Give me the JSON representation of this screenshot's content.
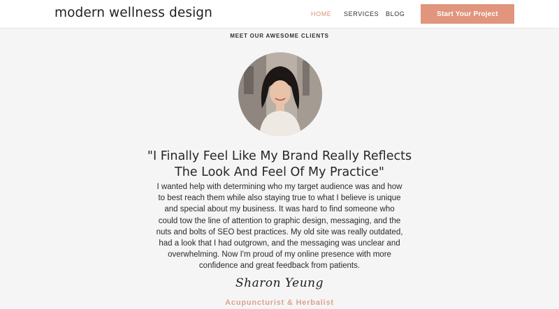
{
  "header": {
    "logo": "modern wellness design",
    "nav": [
      {
        "label": "HOME",
        "active": true
      },
      {
        "label": "SERVICES",
        "active": false
      },
      {
        "label": "BLOG",
        "active": false
      }
    ],
    "cta_label": "Start Your Project"
  },
  "section": {
    "eyebrow": "MEET OUR AWESOME CLIENTS"
  },
  "testimonial": {
    "quote_lines": [
      "\"I Finally Feel Like My Brand Really Reflects",
      "The Look And Feel Of My Practice\""
    ],
    "body_lines": [
      "I wanted help with determining who my target audience was and how",
      "to best reach them while also staying true to what I believe is unique",
      "and special about my business. It was hard to find someone who",
      "could tow the line of attention to graphic design, messaging, and the",
      "nuts and bolts of SEO best practices. My old site was really outdated,",
      "had a look that I had outgrown, and the messaging was unclear and",
      "overwhelming. Now I'm proud of my online presence with more",
      "confidence and great feedback from patients."
    ],
    "signature": "Sharon Yeung",
    "role": "Acupuncturist & Herbalist"
  },
  "colors": {
    "accent": "#e0957c",
    "role_text": "#d9a48f",
    "background": "#f6f5f5"
  },
  "icons": {
    "avatar": "client-portrait-photo"
  }
}
